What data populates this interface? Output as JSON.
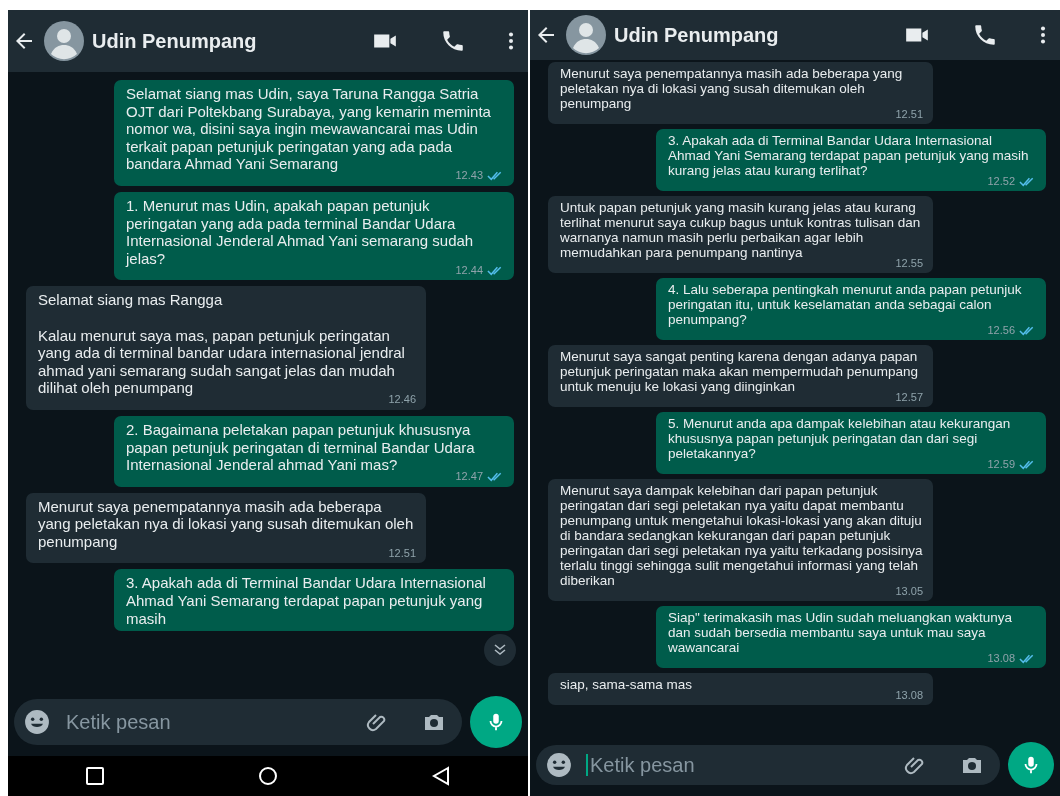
{
  "screens": [
    {
      "header": {
        "contact_name": "Udin Penumpang"
      },
      "messages": [
        {
          "kind": "sent",
          "text": "Selamat siang mas Udin, saya Taruna Rangga Satria OJT dari Poltekbang Surabaya, yang kemarin meminta nomor wa, disini saya ingin mewawancarai mas Udin terkait papan petunjuk peringatan yang ada pada bandara Ahmad Yani Semarang",
          "time": "12.43",
          "read": true
        },
        {
          "kind": "sent",
          "text": "1. Menurut mas Udin, apakah papan petunjuk peringatan yang ada pada terminal Bandar Udara Internasional Jenderal Ahmad Yani semarang sudah jelas?",
          "time": "12.44",
          "read": true
        },
        {
          "kind": "received",
          "text": "Selamat siang mas Rangga\n\nKalau menurut saya mas, papan petunjuk peringatan yang ada di terminal bandar udara internasional jendral ahmad yani semarang sudah sangat jelas dan mudah dilihat oleh penumpang",
          "time": "12.46"
        },
        {
          "kind": "sent",
          "text": "2. Bagaimana peletakan papan petunjuk khususnya papan petunjuk peringatan di terminal Bandar Udara Internasional Jenderal ahmad Yani mas?",
          "time": "12.47",
          "read": true
        },
        {
          "kind": "received",
          "text": "Menurut saya penempatannya masih ada beberapa yang peletakan nya di lokasi yang susah ditemukan oleh penumpang",
          "time": "12.51"
        },
        {
          "kind": "sent",
          "text": "3. Apakah ada di Terminal Bandar Udara Internasional Ahmad Yani Semarang terdapat papan petunjuk yang masih"
        }
      ],
      "scroll_down_button": true,
      "input": {
        "placeholder": "Ketik pesan",
        "focused": false
      },
      "nav_bar": true
    },
    {
      "header": {
        "contact_name": "Udin Penumpang"
      },
      "messages": [
        {
          "kind": "received",
          "text": "Menurut saya penempatannya masih ada beberapa yang peletakan nya di lokasi yang susah ditemukan oleh penumpang",
          "time": "12.51"
        },
        {
          "kind": "sent",
          "text": "3. Apakah ada di Terminal Bandar Udara Internasional Ahmad Yani Semarang terdapat papan petunjuk yang masih kurang jelas atau kurang terlihat?",
          "time": "12.52",
          "read": true
        },
        {
          "kind": "received",
          "text": "Untuk papan petunjuk yang masih kurang jelas atau kurang terlihat menurut saya cukup bagus untuk kontras tulisan dan warnanya namun masih perlu perbaikan agar lebih memudahkan para penumpang nantinya",
          "time": "12.55"
        },
        {
          "kind": "sent",
          "text": "4. Lalu seberapa pentingkah menurut anda papan petunjuk peringatan itu, untuk keselamatan anda sebagai calon penumpang?",
          "time": "12.56",
          "read": true
        },
        {
          "kind": "received",
          "text": "Menurut saya sangat penting karena dengan adanya papan petunjuk peringatan maka akan mempermudah penumpang untuk menuju ke lokasi yang diinginkan",
          "time": "12.57"
        },
        {
          "kind": "sent",
          "text": "5. Menurut anda apa dampak kelebihan atau kekurangan khususnya papan petunjuk peringatan dan dari segi peletakannya?",
          "time": "12.59",
          "read": true
        },
        {
          "kind": "received",
          "text": "Menurut saya dampak kelebihan dari papan petunjuk peringatan dari segi peletakan nya yaitu dapat membantu penumpang untuk mengetahui lokasi-lokasi yang akan dituju di bandara sedangkan kekurangan dari papan petunjuk peringatan dari segi peletakan nya yaitu terkadang posisinya terlalu tinggi sehingga sulit mengetahui informasi yang telah diberikan",
          "time": "13.05"
        },
        {
          "kind": "sent",
          "text": "Siap\" terimakasih mas Udin sudah meluangkan waktunya dan sudah bersedia membantu saya untuk mau saya wawancarai",
          "time": "13.08",
          "read": true
        },
        {
          "kind": "received",
          "text": "siap, sama-sama mas",
          "time": "13.08"
        }
      ],
      "scroll_down_button": false,
      "input": {
        "placeholder": "Ketik pesan",
        "focused": true
      },
      "nav_bar": false
    }
  ]
}
